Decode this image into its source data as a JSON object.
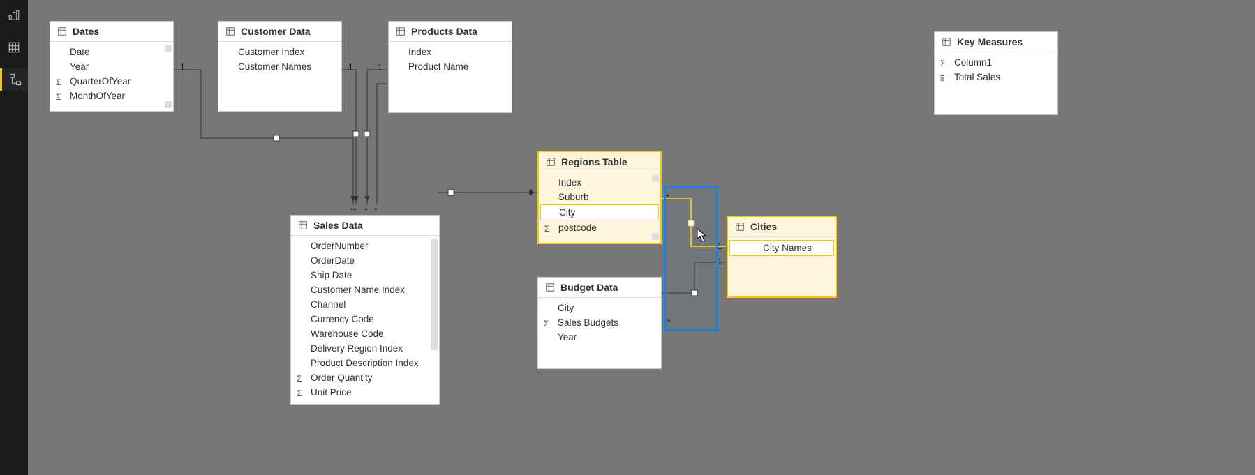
{
  "rail": {
    "report": "Report view",
    "data": "Data view",
    "model": "Model view"
  },
  "tables": {
    "dates": {
      "title": "Dates",
      "fields": [
        "Date",
        "Year",
        "QuarterOfYear",
        "MonthOfYear"
      ]
    },
    "customer": {
      "title": "Customer Data",
      "fields": [
        "Customer Index",
        "Customer Names"
      ]
    },
    "products": {
      "title": "Products Data",
      "fields": [
        "Index",
        "Product Name"
      ]
    },
    "regions": {
      "title": "Regions Table",
      "fields": [
        "Index",
        "Suburb",
        "City",
        "postcode"
      ]
    },
    "sales": {
      "title": "Sales Data",
      "fields": [
        "OrderNumber",
        "OrderDate",
        "Ship Date",
        "Customer Name Index",
        "Channel",
        "Currency Code",
        "Warehouse Code",
        "Delivery Region Index",
        "Product Description Index",
        "Order Quantity",
        "Unit Price"
      ]
    },
    "budget": {
      "title": "Budget Data",
      "fields": [
        "City",
        "Sales Budgets",
        "Year"
      ]
    },
    "cities": {
      "title": "Cities",
      "fields": [
        "City Names"
      ]
    },
    "measures": {
      "title": "Key Measures",
      "fields": [
        "Column1",
        "Total Sales"
      ]
    }
  },
  "cardinality": {
    "one": "1",
    "many": "*"
  }
}
